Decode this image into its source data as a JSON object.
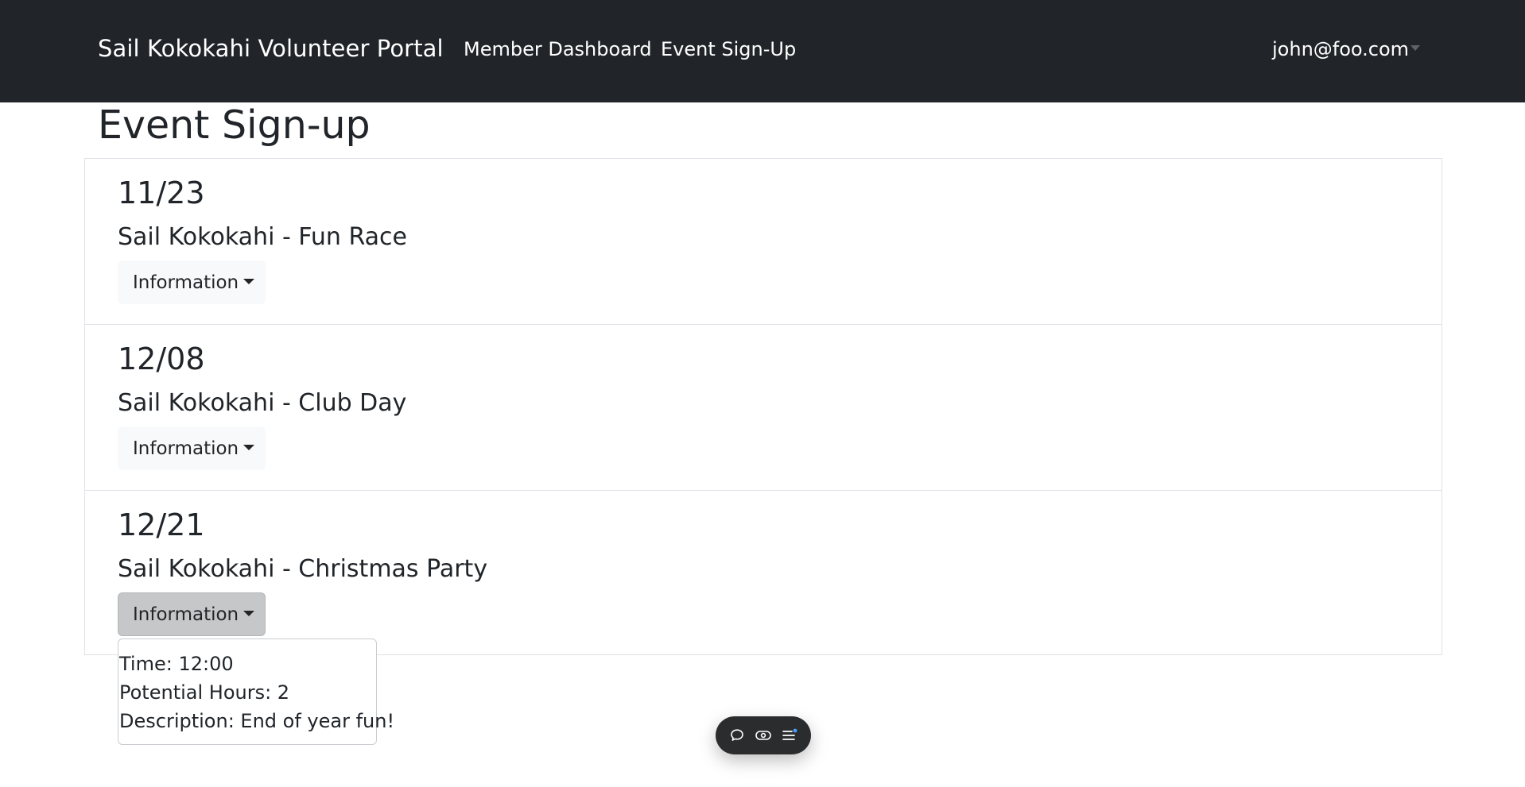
{
  "navbar": {
    "brand": "Sail Kokokahi Volunteer Portal",
    "links": [
      {
        "label": "Member Dashboard"
      },
      {
        "label": "Event Sign-Up"
      }
    ],
    "user_email": "john@foo.com"
  },
  "page": {
    "title": "Event Sign-up"
  },
  "events": [
    {
      "date": "11/23",
      "name": "Sail Kokokahi - Fun Race",
      "button_label": "Information"
    },
    {
      "date": "12/08",
      "name": "Sail Kokokahi - Club Day",
      "button_label": "Information"
    },
    {
      "date": "12/21",
      "name": "Sail Kokokahi - Christmas Party",
      "button_label": "Information"
    }
  ],
  "open_dropdown": {
    "time": "Time: 12:00",
    "hours": "Potential Hours: 2",
    "description": "Description: End of year fun!"
  },
  "toolbar": {
    "icons": [
      "comment-icon",
      "eye-icon",
      "menu-icon"
    ],
    "accent_color": "#4a9eff"
  },
  "colors": {
    "navbar_bg": "#212529",
    "button_bg": "#f8f9fa",
    "button_active_bg": "#c6c7c8"
  }
}
